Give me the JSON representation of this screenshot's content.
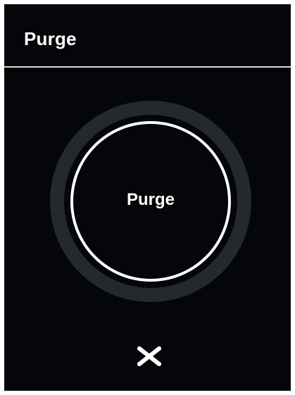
{
  "screen": {
    "title": "Purge"
  },
  "main": {
    "button_label": "Purge"
  },
  "footer": {
    "close_icon": "close-icon"
  },
  "colors": {
    "background": "#05060a",
    "text": "#ffffff",
    "ring": "#242a2c",
    "divider": "#d9d9d9"
  }
}
